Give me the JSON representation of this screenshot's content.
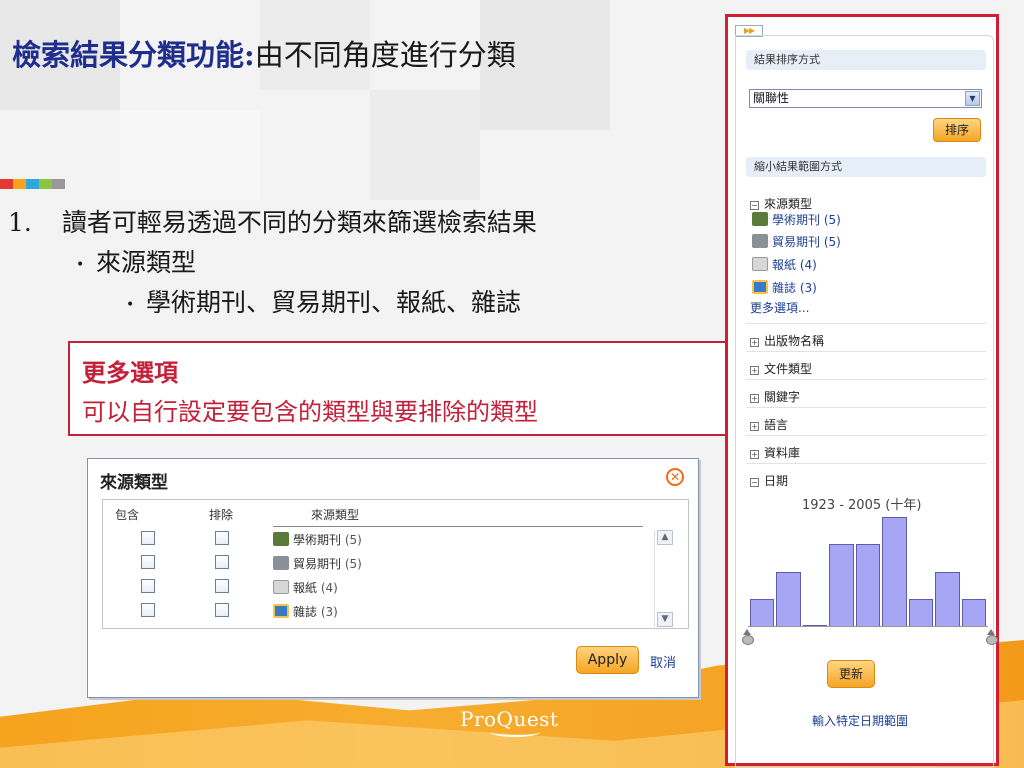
{
  "slide": {
    "title_emphasis": "檢索結果分類功能:",
    "title_rest": "由不同角度進行分類",
    "accent_colors": [
      "#e23a2e",
      "#f6a31d",
      "#2fa8e0",
      "#8cc63f",
      "#999999"
    ],
    "bullet1_num": "1.",
    "bullet1": "讀者可輕易透過不同的分類來篩選檢索結果",
    "bullet2": "來源類型",
    "bullet3": "學術期刊、貿易期刊、報紙、雜誌",
    "callout_title": "更多選項",
    "callout_body": "可以自行設定要包含的類型與要排除的類型",
    "logo": "ProQuest"
  },
  "dialog": {
    "title": "來源類型",
    "col_include": "包含",
    "col_exclude": "排除",
    "col_source": "來源類型",
    "rows": [
      {
        "label": "學術期刊",
        "count": "(5)",
        "icon": "scholarly-journal-icon"
      },
      {
        "label": "貿易期刊",
        "count": "(5)",
        "icon": "trade-journal-icon"
      },
      {
        "label": "報紙",
        "count": "(4)",
        "icon": "newspaper-icon"
      },
      {
        "label": "雜誌",
        "count": "(3)",
        "icon": "magazine-icon"
      }
    ],
    "apply": "Apply",
    "cancel": "取消"
  },
  "panel": {
    "sort_header": "結果排序方式",
    "sort_value": "關聯性",
    "sort_button": "排序",
    "narrow_header": "縮小結果範圍方式",
    "source_type": "來源類型",
    "sources": [
      {
        "label": "學術期刊",
        "count": "(5)"
      },
      {
        "label": "貿易期刊",
        "count": "(5)"
      },
      {
        "label": "報紙",
        "count": "(4)"
      },
      {
        "label": "雜誌",
        "count": "(3)"
      }
    ],
    "more_options": "更多選項...",
    "facets": [
      "出版物名稱",
      "文件類型",
      "關鍵字",
      "語言",
      "資料庫"
    ],
    "date_facet": "日期",
    "date_range": "1923 - 2005 (十年)",
    "histogram_values": [
      1,
      2,
      0,
      3,
      3,
      4,
      1,
      2,
      1
    ],
    "update_button": "更新",
    "enter_date_link": "輸入特定日期範圍"
  }
}
